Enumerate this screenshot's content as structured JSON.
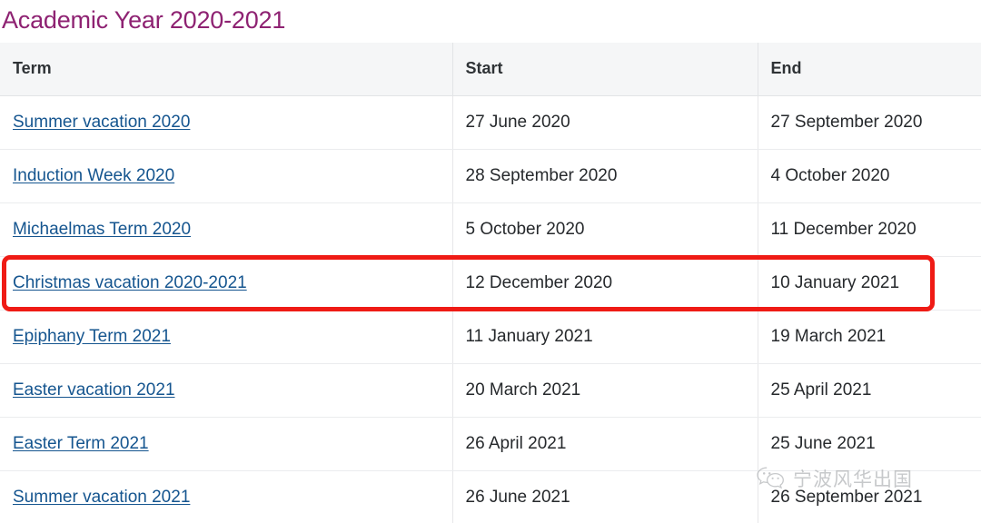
{
  "page": {
    "title": "Academic Year 2020-2021",
    "title_color": "#8e2272",
    "link_color": "#15558f",
    "highlight_color": "#ef1b15"
  },
  "table": {
    "columns": [
      "Term",
      "Start",
      "End"
    ],
    "rows": [
      {
        "term": "Summer vacation 2020",
        "start": "27 June 2020",
        "end": "27 September 2020",
        "highlighted": false
      },
      {
        "term": "Induction Week 2020",
        "start": "28 September 2020",
        "end": "4 October 2020",
        "highlighted": false
      },
      {
        "term": "Michaelmas Term 2020",
        "start": "5 October 2020",
        "end": "11 December 2020",
        "highlighted": false
      },
      {
        "term": "Christmas vacation 2020-2021",
        "start": "12 December 2020",
        "end": "10 January 2021",
        "highlighted": true
      },
      {
        "term": "Epiphany Term 2021",
        "start": "11 January 2021",
        "end": "19 March 2021",
        "highlighted": false
      },
      {
        "term": "Easter vacation 2021",
        "start": "20 March 2021",
        "end": "25 April 2021",
        "highlighted": false
      },
      {
        "term": "Easter Term 2021",
        "start": "26 April 2021",
        "end": "25 June 2021",
        "highlighted": false
      },
      {
        "term": "Summer vacation 2021",
        "start": "26 June 2021",
        "end": "26 September 2021",
        "highlighted": false
      }
    ]
  },
  "watermark": {
    "icon": "wechat-icon",
    "text": "宁波风华出国"
  }
}
